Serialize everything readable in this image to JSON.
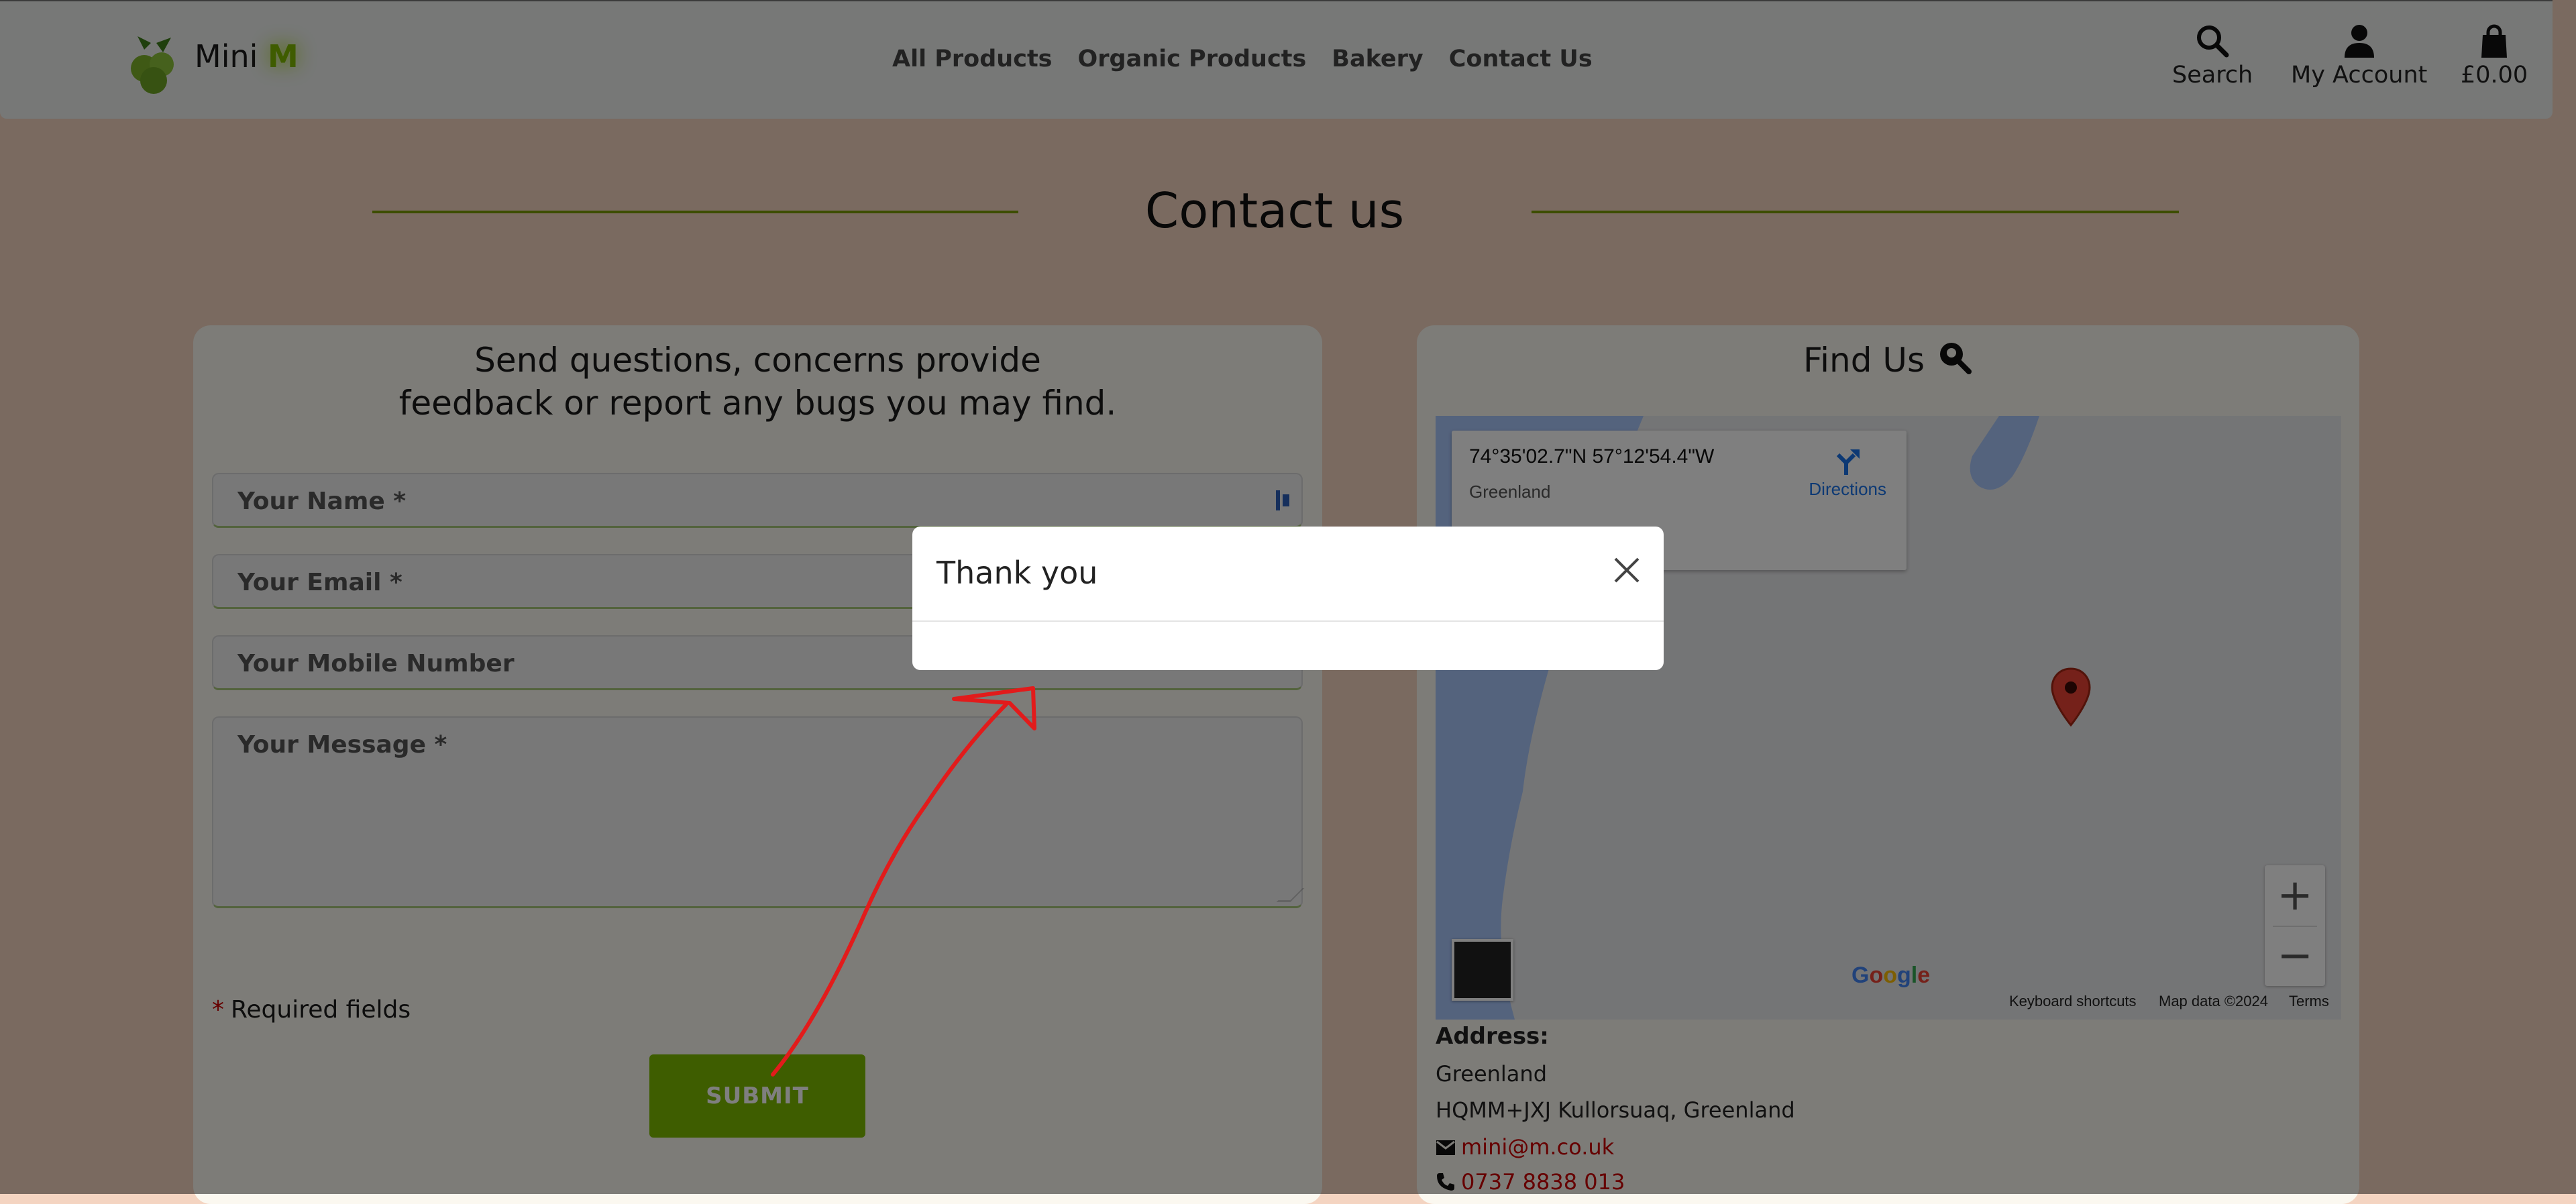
{
  "header": {
    "brand_prefix": "Mini",
    "brand_suffix": "M",
    "nav": [
      "All Products",
      "Organic Products",
      "Bakery",
      "Contact Us"
    ],
    "search_label": "Search",
    "account_label": "My Account",
    "cart_total": "£0.00"
  },
  "page": {
    "title": "Contact us"
  },
  "form": {
    "heading_line1": "Send questions, concerns provide",
    "heading_line2": "feedback or report any bugs you may find.",
    "name_placeholder": "Your Name *",
    "email_placeholder": "Your Email *",
    "mobile_placeholder": "Your Mobile Number",
    "message_placeholder": "Your Message *",
    "required_star": "*",
    "required_text": "Required fields",
    "submit_label": "SUBMIT"
  },
  "find_us": {
    "heading": "Find Us",
    "map": {
      "coordinates": "74°35'02.7\"N 57°12'54.4\"W",
      "region": "Greenland",
      "directions_label": "Directions",
      "google": "Google",
      "keyboard_shortcuts": "Keyboard shortcuts",
      "map_data": "Map data ©2024",
      "terms": "Terms",
      "zoom_in": "+",
      "zoom_out": "−"
    },
    "address_label": "Address:",
    "address_line1": "Greenland",
    "address_line2": "HQMM+JXJ Kullorsuaq, Greenland",
    "email": "mini@m.co.uk",
    "phone": "0737 8838 013"
  },
  "modal": {
    "title": "Thank you"
  },
  "colors": {
    "accent": "#7cba00",
    "link": "#cc0000",
    "overlay": "rgba(0,0,0,0.5)"
  }
}
